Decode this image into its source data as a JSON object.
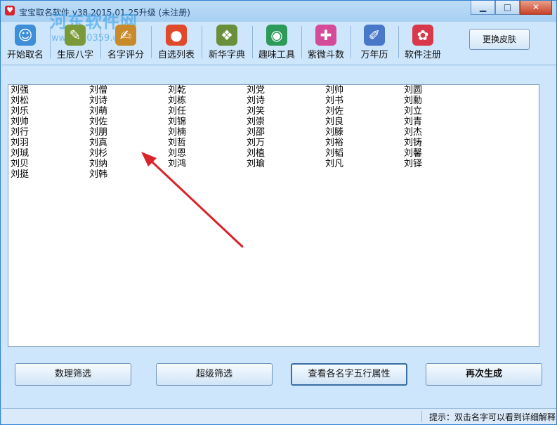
{
  "window": {
    "title": "宝宝取名软件 v38  2015.01.25升级 (未注册)",
    "watermark": "河东软件网",
    "watermark_sub": "www.pc0359.cn",
    "minimize": "▁",
    "maximize": "□",
    "close": "✕"
  },
  "toolbar": {
    "items": [
      {
        "label": "开始取名",
        "icon": "baby-icon",
        "glyph": "☺",
        "color": "#3c8fd8"
      },
      {
        "label": "生辰八字",
        "icon": "calendar-tools-icon",
        "glyph": "✎",
        "color": "#7a9a3a"
      },
      {
        "label": "名字评分",
        "icon": "score-board-icon",
        "glyph": "✍",
        "color": "#c98a2b"
      },
      {
        "label": "自选列表",
        "icon": "list-icon",
        "glyph": "●",
        "color": "#e04a2a"
      },
      {
        "label": "新华字典",
        "icon": "dictionary-icon",
        "glyph": "❖",
        "color": "#6a8f3a"
      },
      {
        "label": "趣味工具",
        "icon": "globe-icon",
        "glyph": "◉",
        "color": "#2e9a5a"
      },
      {
        "label": "紫微斗数",
        "icon": "chat-icon",
        "glyph": "✚",
        "color": "#d64a9a"
      },
      {
        "label": "万年历",
        "icon": "calendar-pen-icon",
        "glyph": "✐",
        "color": "#4a78c8"
      },
      {
        "label": "软件注册",
        "icon": "flower-icon",
        "glyph": "✿",
        "color": "#d8384a"
      }
    ],
    "skin_button": "更换皮肤"
  },
  "names": {
    "columns": [
      [
        "刘强",
        "刘松",
        "刘乐",
        "刘帅",
        "刘行",
        "刘羽",
        "刘珹",
        "刘贝",
        "刘挺"
      ],
      [
        "刘僧",
        "刘诗",
        "刘萌",
        "刘佐",
        "刘朋",
        "刘真",
        "刘杉",
        "刘纳",
        "刘韩"
      ],
      [
        "刘乾",
        "刘栋",
        "刘任",
        "刘锦",
        "刘楠",
        "刘哲",
        "刘恩",
        "刘鸿"
      ],
      [
        "刘党",
        "刘诗",
        "刘笑",
        "刘崇",
        "刘邵",
        "刘万",
        "刘植",
        "刘瑜"
      ],
      [
        "刘帅",
        "刘书",
        "刘佐",
        "刘良",
        "刘滕",
        "刘裕",
        "刘韬",
        "刘凡"
      ],
      [
        "刘圆",
        "刘勳",
        "刘立",
        "刘青",
        "刘杰",
        "刘铸",
        "刘馨",
        "刘铎"
      ]
    ]
  },
  "buttons": {
    "numerology_filter": "数理筛选",
    "super_filter": "超级筛选",
    "five_elements": "查看各名字五行属性",
    "regenerate": "再次生成"
  },
  "status": {
    "hint": "提示：双击名字可以看到详细解释"
  },
  "colors": {
    "window_bg": "#cde6fb",
    "arrow": "#d8232a"
  }
}
